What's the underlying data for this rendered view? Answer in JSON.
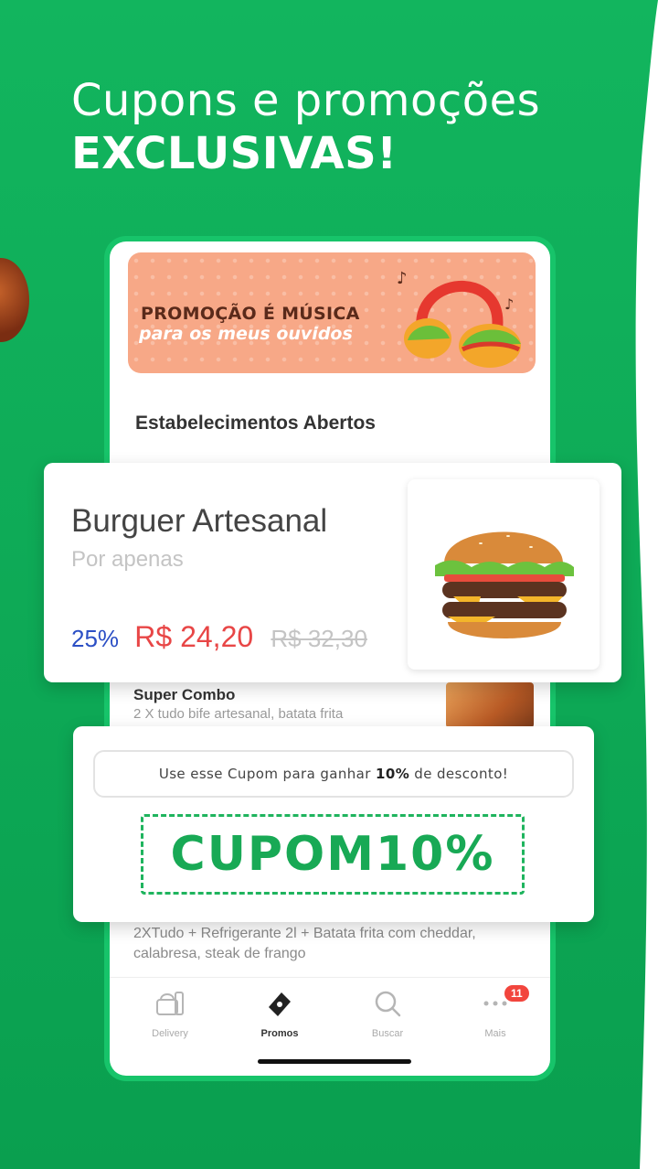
{
  "headline": {
    "line1": "Cupons e promoções",
    "line2": "EXCLUSIVAS!"
  },
  "banner": {
    "title": "PROMOÇÃO É MÚSICA",
    "subtitle": "para os meus ouvidos"
  },
  "section_title": "Estabelecimentos Abertos",
  "featured": {
    "name": "Burguer Artesanal",
    "subtitle": "Por apenas",
    "discount": "25%",
    "price": "R$ 24,20",
    "old_price": "R$ 32,30"
  },
  "list": [
    {
      "title": "Super Combo",
      "description": "2 X tudo bife artesanal, batata frita"
    },
    {
      "description": "2XTudo + Refrigerante 2l + Batata frita com cheddar, calabresa, steak de frango"
    }
  ],
  "coupon": {
    "hint_prefix": "Use esse Cupom para ganhar ",
    "hint_bold": "10%",
    "hint_suffix": " de desconto!",
    "code": "CUPOM10%"
  },
  "tabs": [
    {
      "label": "Delivery",
      "icon": "delivery-icon"
    },
    {
      "label": "Promos",
      "icon": "ticket-icon",
      "active": true
    },
    {
      "label": "Buscar",
      "icon": "search-icon"
    },
    {
      "label": "Mais",
      "icon": "more-icon",
      "badge": "11"
    }
  ],
  "colors": {
    "brand_green": "#0daa55",
    "price_red": "#e84646",
    "discount_blue": "#2b4fc5"
  }
}
